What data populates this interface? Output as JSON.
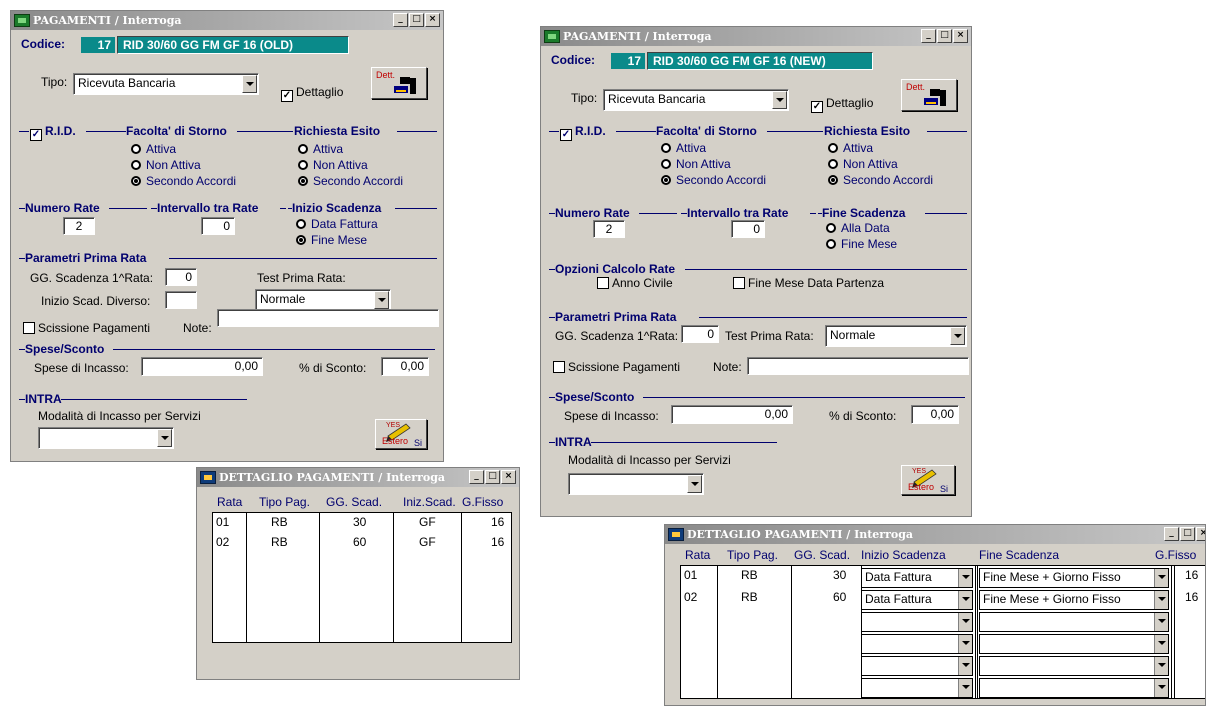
{
  "left": {
    "title": "PAGAMENTI / Interroga",
    "codice_label": "Codice:",
    "codice_num": "17",
    "codice_desc": "RID 30/60 GG FM GF 16 (OLD)",
    "tipo_label": "Tipo:",
    "tipo_value": "Ricevuta Bancaria",
    "dettaglio_label": "Dettaglio",
    "dett_btn": "Dett.",
    "rid_label": "R.I.D.",
    "storno_title": "Facolta' di Storno",
    "storno_opts": [
      "Attiva",
      "Non Attiva",
      "Secondo Accordi"
    ],
    "esito_title": "Richiesta Esito",
    "esito_opts": [
      "Attiva",
      "Non Attiva",
      "Secondo Accordi"
    ],
    "numrate_title": "Numero Rate",
    "numrate_value": "2",
    "intervallo_title": "Intervallo tra Rate",
    "intervallo_value": "0",
    "inizio_title": "Inizio Scadenza",
    "inizio_opts": [
      "Data Fattura",
      "Fine Mese"
    ],
    "prima_title": "Parametri Prima Rata",
    "gg_label": "GG. Scadenza 1^Rata:",
    "gg_value": "0",
    "test_label": "Test Prima Rata:",
    "inizio_diverso_label": "Inizio Scad. Diverso:",
    "test_value": "Normale",
    "scissione_label": "Scissione Pagamenti",
    "note_label": "Note:",
    "spese_title": "Spese/Sconto",
    "spese_label": "Spese di Incasso:",
    "spese_value": "0,00",
    "sconto_label": "% di Sconto:",
    "sconto_value": "0,00",
    "intra_title": "INTRA",
    "modalita_label": "Modalità di Incasso per Servizi",
    "estero_label": "Estero",
    "si_label": "Si",
    "yes_label": "YES"
  },
  "right": {
    "title": "PAGAMENTI / Interroga",
    "codice_label": "Codice:",
    "codice_num": "17",
    "codice_desc": "RID 30/60 GG FM GF 16 (NEW)",
    "tipo_label": "Tipo:",
    "tipo_value": "Ricevuta Bancaria",
    "dettaglio_label": "Dettaglio",
    "dett_btn": "Dett.",
    "rid_label": "R.I.D.",
    "storno_title": "Facolta' di Storno",
    "storno_opts": [
      "Attiva",
      "Non Attiva",
      "Secondo Accordi"
    ],
    "esito_title": "Richiesta Esito",
    "esito_opts": [
      "Attiva",
      "Non Attiva",
      "Secondo Accordi"
    ],
    "numrate_title": "Numero Rate",
    "numrate_value": "2",
    "intervallo_title": "Intervallo tra Rate",
    "intervallo_value": "0",
    "fine_title": "Fine Scadenza",
    "fine_opts": [
      "Alla Data",
      "Fine Mese"
    ],
    "opzioni_title": "Opzioni Calcolo Rate",
    "anno_civile": "Anno Civile",
    "fine_mese_partenza": "Fine Mese Data Partenza",
    "prima_title": "Parametri Prima Rata",
    "gg_label": "GG. Scadenza 1^Rata:",
    "gg_value": "0",
    "test_label": "Test Prima Rata:",
    "test_value": "Normale",
    "scissione_label": "Scissione Pagamenti",
    "note_label": "Note:",
    "spese_title": "Spese/Sconto",
    "spese_label": "Spese di Incasso:",
    "spese_value": "0,00",
    "sconto_label": "% di Sconto:",
    "sconto_value": "0,00",
    "intra_title": "INTRA",
    "modalita_label": "Modalità di Incasso per Servizi",
    "estero_label": "Estero",
    "si_label": "Si",
    "yes_label": "YES"
  },
  "detail_left": {
    "title": "DETTAGLIO PAGAMENTI / Interroga",
    "headers": [
      "Rata",
      "Tipo Pag.",
      "GG. Scad.",
      "Iniz.Scad.",
      "G.Fisso"
    ],
    "rows": [
      [
        "01",
        "RB",
        "30",
        "GF",
        "16"
      ],
      [
        "02",
        "RB",
        "60",
        "GF",
        "16"
      ]
    ]
  },
  "detail_right": {
    "title": "DETTAGLIO PAGAMENTI / Interroga",
    "headers": [
      "Rata",
      "Tipo Pag.",
      "GG. Scad.",
      "Inizio Scadenza",
      "Fine Scadenza",
      "G.Fisso"
    ],
    "rows": [
      [
        "01",
        "RB",
        "30",
        "Data Fattura",
        "Fine Mese + Giorno Fisso",
        "16"
      ],
      [
        "02",
        "RB",
        "60",
        "Data Fattura",
        "Fine Mese + Giorno Fisso",
        "16"
      ]
    ]
  }
}
